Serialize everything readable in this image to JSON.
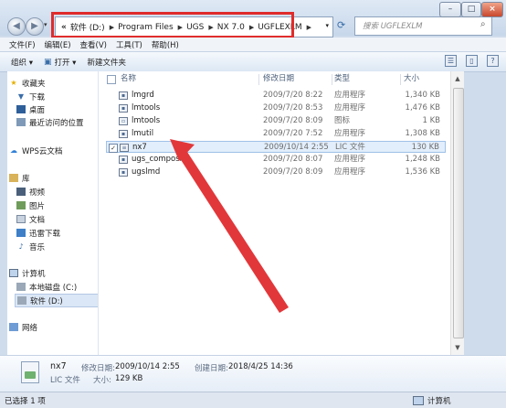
{
  "titlebar": {
    "breadcrumb": [
      "软件 (D:)",
      "Program Files",
      "UGS",
      "NX 7.0",
      "UGFLEXLM"
    ],
    "breadcrumb_prefix": "«",
    "search_placeholder": "搜索 UGFLEXLM",
    "controls": {
      "minimize": "–",
      "maximize": "□",
      "close": "×"
    }
  },
  "menu": [
    "文件(F)",
    "编辑(E)",
    "查看(V)",
    "工具(T)",
    "帮助(H)"
  ],
  "toolbar": {
    "organize": "组织 ▾",
    "open": "打开 ▾",
    "new_folder": "新建文件夹"
  },
  "nav": {
    "favorites": "收藏夹",
    "favorites_items": [
      "下载",
      "桌面",
      "最近访问的位置"
    ],
    "wps": "WPS云文档",
    "library": "库",
    "library_items": [
      "视频",
      "图片",
      "文档",
      "迅雷下载",
      "音乐"
    ],
    "computer": "计算机",
    "computer_items": [
      "本地磁盘 (C:)",
      "软件 (D:)"
    ],
    "network": "网络"
  },
  "columns": {
    "name": "名称",
    "date": "修改日期",
    "type": "类型",
    "size": "大小"
  },
  "files": [
    {
      "name": "lmgrd",
      "date": "2009/7/20 8:22",
      "type": "应用程序",
      "size": "1,340 KB"
    },
    {
      "name": "lmtools",
      "date": "2009/7/20 8:53",
      "type": "应用程序",
      "size": "1,476 KB"
    },
    {
      "name": "lmtools",
      "date": "2009/7/20 8:09",
      "type": "图标",
      "size": "1 KB"
    },
    {
      "name": "lmutil",
      "date": "2009/7/20 7:52",
      "type": "应用程序",
      "size": "1,308 KB"
    },
    {
      "name": "nx7",
      "date": "2009/10/14 2:55",
      "type": "LIC 文件",
      "size": "130 KB",
      "selected": true,
      "checked": "✓"
    },
    {
      "name": "ugs_composite",
      "date": "2009/7/20 8:07",
      "type": "应用程序",
      "size": "1,248 KB"
    },
    {
      "name": "ugslmd",
      "date": "2009/7/20 8:09",
      "type": "应用程序",
      "size": "1,536 KB"
    }
  ],
  "details": {
    "name": "nx7",
    "modified_label": "修改日期:",
    "modified": "2009/10/14 2:55",
    "created_label": "创建日期:",
    "created": "2018/4/25 14:36",
    "type": "LIC 文件",
    "size_label": "大小:",
    "size": "129 KB"
  },
  "status": {
    "left": "已选择 1 项",
    "right": "计算机"
  },
  "accent": {
    "highlight_box": "#e02c2c",
    "arrow": "#e2373a"
  }
}
